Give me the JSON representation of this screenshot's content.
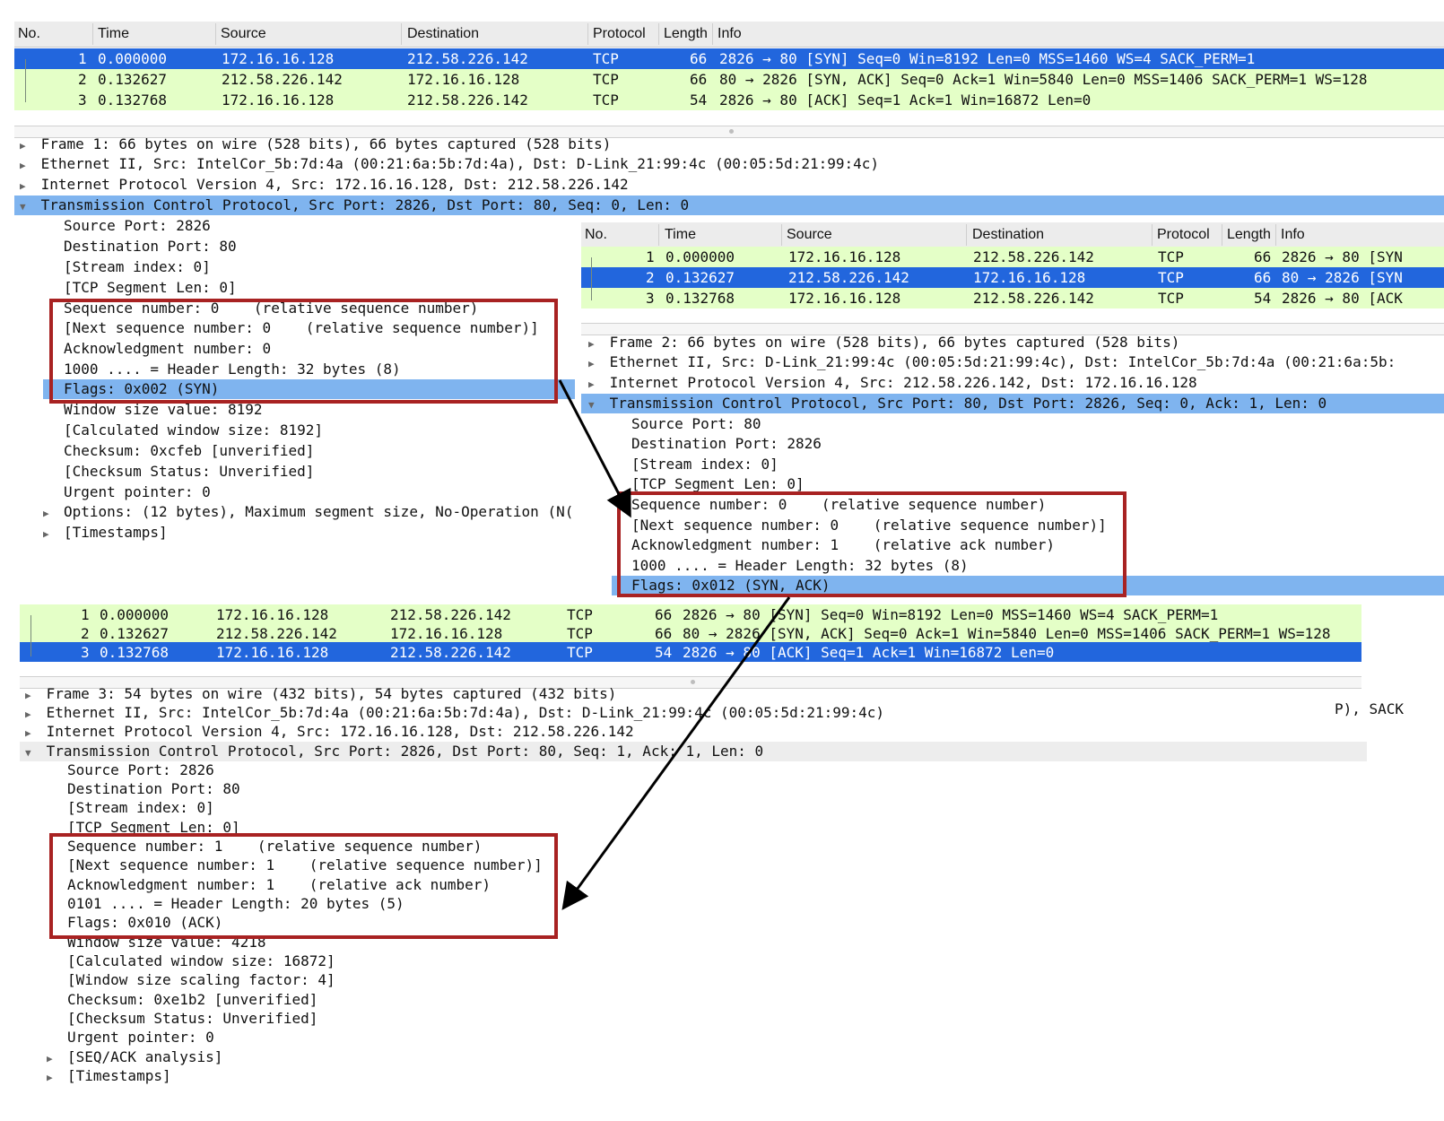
{
  "columns": [
    "No.",
    "Time",
    "Source",
    "Destination",
    "Protocol",
    "Length",
    "Info"
  ],
  "panel1": {
    "packets": [
      {
        "no": "1",
        "time": "0.000000",
        "src": "172.16.16.128",
        "dst": "212.58.226.142",
        "proto": "TCP",
        "len": "66",
        "info": "2826 → 80 [SYN] Seq=0 Win=8192 Len=0 MSS=1460 WS=4 SACK_PERM=1"
      },
      {
        "no": "2",
        "time": "0.132627",
        "src": "212.58.226.142",
        "dst": "172.16.16.128",
        "proto": "TCP",
        "len": "66",
        "info": "80 → 2826 [SYN, ACK] Seq=0 Ack=1 Win=5840 Len=0 MSS=1406 SACK_PERM=1 WS=128"
      },
      {
        "no": "3",
        "time": "0.132768",
        "src": "172.16.16.128",
        "dst": "212.58.226.142",
        "proto": "TCP",
        "len": "54",
        "info": "2826 → 80 [ACK] Seq=1 Ack=1 Win=16872 Len=0"
      }
    ],
    "tree": [
      "Frame 1: 66 bytes on wire (528 bits), 66 bytes captured (528 bits)",
      "Ethernet II, Src: IntelCor_5b:7d:4a (00:21:6a:5b:7d:4a), Dst: D-Link_21:99:4c (00:05:5d:21:99:4c)",
      "Internet Protocol Version 4, Src: 172.16.16.128, Dst: 212.58.226.142",
      "Transmission Control Protocol, Src Port: 2826, Dst Port: 80, Seq: 0, Len: 0"
    ],
    "fields": [
      "Source Port: 2826",
      "Destination Port: 80",
      "[Stream index: 0]",
      "[TCP Segment Len: 0]",
      "Sequence number: 0    (relative sequence number)",
      "[Next sequence number: 0    (relative sequence number)]",
      "Acknowledgment number: 0",
      "1000 .... = Header Length: 32 bytes (8)",
      "Flags: 0x002 (SYN)",
      "Window size value: 8192",
      "[Calculated window size: 8192]",
      "Checksum: 0xcfeb [unverified]",
      "[Checksum Status: Unverified]",
      "Urgent pointer: 0",
      "Options: (12 bytes), Maximum segment size, No-Operation (N(",
      "[Timestamps]"
    ]
  },
  "panel2": {
    "packets": [
      {
        "no": "1",
        "time": "0.000000",
        "src": "172.16.16.128",
        "dst": "212.58.226.142",
        "proto": "TCP",
        "len": "66",
        "info": "2826 → 80 [SYN"
      },
      {
        "no": "2",
        "time": "0.132627",
        "src": "212.58.226.142",
        "dst": "172.16.16.128",
        "proto": "TCP",
        "len": "66",
        "info": "80 → 2826 [SYN"
      },
      {
        "no": "3",
        "time": "0.132768",
        "src": "172.16.16.128",
        "dst": "212.58.226.142",
        "proto": "TCP",
        "len": "54",
        "info": "2826 → 80 [ACK"
      }
    ],
    "tree": [
      "Frame 2: 66 bytes on wire (528 bits), 66 bytes captured (528 bits)",
      "Ethernet II, Src: D-Link_21:99:4c (00:05:5d:21:99:4c), Dst: IntelCor_5b:7d:4a (00:21:6a:5b:",
      "Internet Protocol Version 4, Src: 212.58.226.142, Dst: 172.16.16.128",
      "Transmission Control Protocol, Src Port: 80, Dst Port: 2826, Seq: 0, Ack: 1, Len: 0"
    ],
    "fields": [
      "Source Port: 80",
      "Destination Port: 2826",
      "[Stream index: 0]",
      "[TCP Segment Len: 0]",
      "Sequence number: 0    (relative sequence number)",
      "[Next sequence number: 0    (relative sequence number)]",
      "Acknowledgment number: 1    (relative ack number)",
      "1000 .... = Header Length: 32 bytes (8)",
      "Flags: 0x012 (SYN, ACK)"
    ],
    "overflow_text": "P), SACK"
  },
  "panel3": {
    "packets": [
      {
        "no": "1",
        "time": "0.000000",
        "src": "172.16.16.128",
        "dst": "212.58.226.142",
        "proto": "TCP",
        "len": "66",
        "info": "2826 → 80 [SYN] Seq=0 Win=8192 Len=0 MSS=1460 WS=4 SACK_PERM=1"
      },
      {
        "no": "2",
        "time": "0.132627",
        "src": "212.58.226.142",
        "dst": "172.16.16.128",
        "proto": "TCP",
        "len": "66",
        "info": "80 → 2826 [SYN, ACK] Seq=0 Ack=1 Win=5840 Len=0 MSS=1406 SACK_PERM=1 WS=128"
      },
      {
        "no": "3",
        "time": "0.132768",
        "src": "172.16.16.128",
        "dst": "212.58.226.142",
        "proto": "TCP",
        "len": "54",
        "info": "2826 → 80 [ACK] Seq=1 Ack=1 Win=16872 Len=0"
      }
    ],
    "tree": [
      "Frame 3: 54 bytes on wire (432 bits), 54 bytes captured (432 bits)",
      "Ethernet II, Src: IntelCor_5b:7d:4a (00:21:6a:5b:7d:4a), Dst: D-Link_21:99:4c (00:05:5d:21:99:4c)",
      "Internet Protocol Version 4, Src: 172.16.16.128, Dst: 212.58.226.142",
      "Transmission Control Protocol, Src Port: 2826, Dst Port: 80, Seq: 1, Ack: 1, Len: 0"
    ],
    "fields": [
      "Source Port: 2826",
      "Destination Port: 80",
      "[Stream index: 0]",
      "[TCP Segment Len: 0]",
      "Sequence number: 1    (relative sequence number)",
      "[Next sequence number: 1    (relative sequence number)]",
      "Acknowledgment number: 1    (relative ack number)",
      "0101 .... = Header Length: 20 bytes (5)",
      "Flags: 0x010 (ACK)",
      "Window size value: 4218",
      "[Calculated window size: 16872]",
      "[Window size scaling factor: 4]",
      "Checksum: 0xe1b2 [unverified]",
      "[Checksum Status: Unverified]",
      "Urgent pointer: 0",
      "[SEQ/ACK analysis]",
      "[Timestamps]"
    ]
  },
  "colors": {
    "selected": "#2266dd",
    "row_green": "#e4ffc7",
    "tree_highlight": "#7fb4ef",
    "annotation": "#a82222"
  },
  "icons": {
    "expand": "triangle-right",
    "collapse": "triangle-down"
  }
}
